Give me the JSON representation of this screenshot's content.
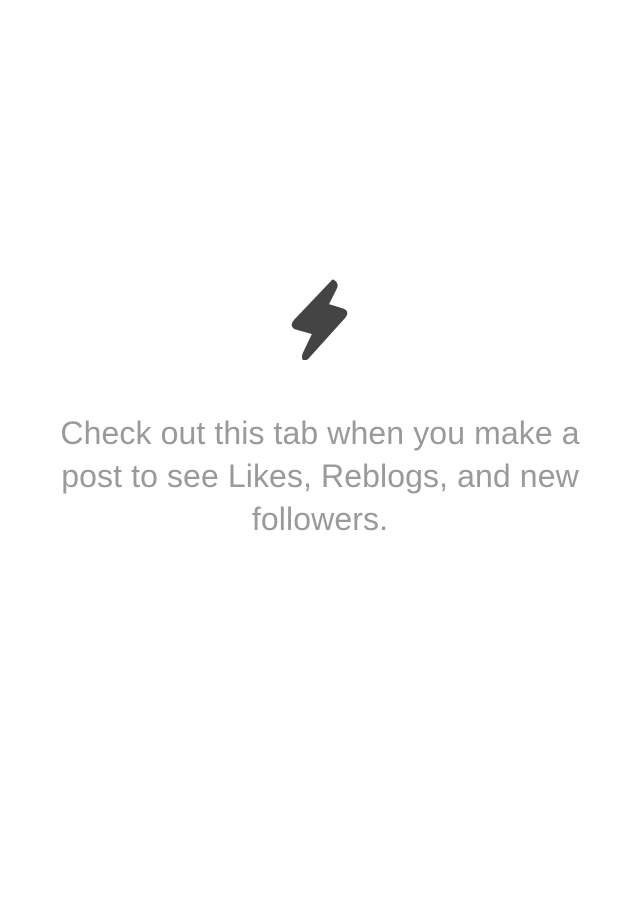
{
  "activity": {
    "empty_state": {
      "icon": "lightning-bolt-icon",
      "icon_color": "#444444",
      "message": "Check out this tab when you make a post to see Likes, Reblogs, and new followers.",
      "message_color": "#9a9a9a",
      "background": "#ffffff"
    }
  }
}
